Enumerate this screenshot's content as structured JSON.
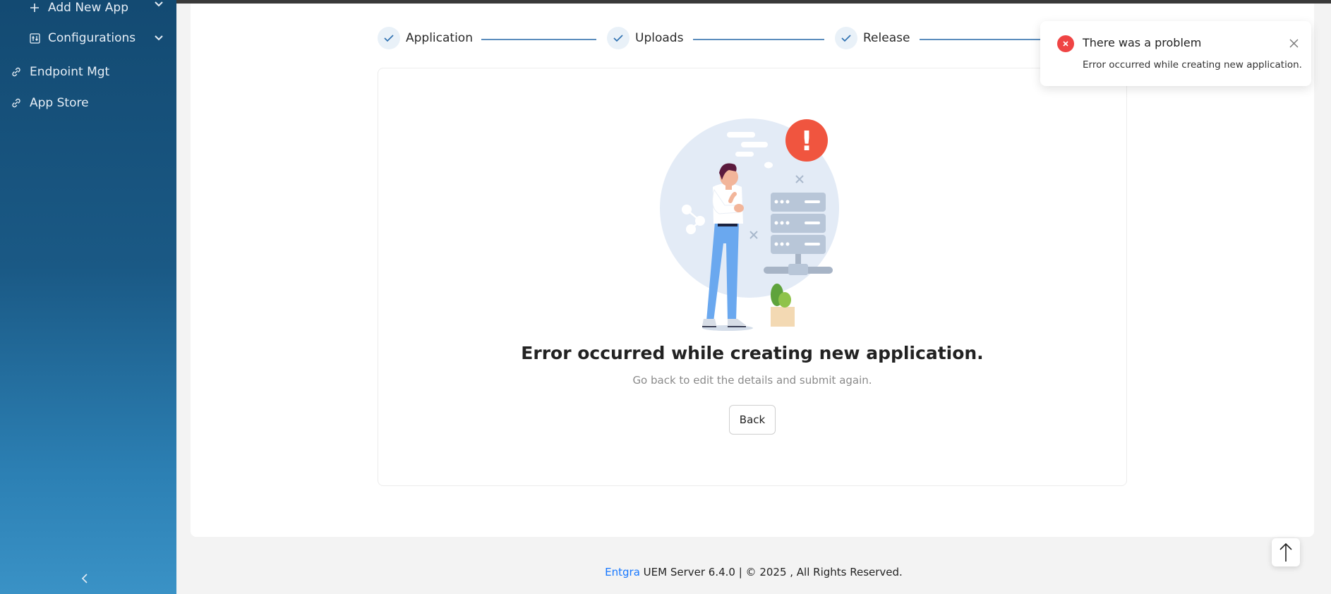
{
  "sidebar": {
    "items": [
      {
        "label": "Add New App",
        "icon": "plus-icon",
        "has_chevron": true
      },
      {
        "label": "Configurations",
        "icon": "sliders-icon",
        "has_chevron": true
      },
      {
        "label": "Endpoint Mgt",
        "icon": "link-icon"
      },
      {
        "label": "App Store",
        "icon": "link-icon"
      }
    ],
    "collapse_icon": "chevron-left-icon"
  },
  "steps": [
    {
      "label": "Application",
      "status": "done"
    },
    {
      "label": "Uploads",
      "status": "done"
    },
    {
      "label": "Release",
      "status": "done"
    }
  ],
  "result": {
    "title": "Error occurred while creating new application.",
    "subtitle": "Go back to edit the details and submit again.",
    "back_label": "Back",
    "illustration_mark": "!"
  },
  "toast": {
    "title": "There was a problem",
    "message": "Error occurred while creating new application.",
    "type": "error"
  },
  "footer": {
    "brand": "Entgra",
    "text": " UEM Server 6.4.0 | © 2025 , All Rights Reserved."
  },
  "colors": {
    "sidebar_top": "#134a72",
    "sidebar_bottom": "#3a92c6",
    "accent": "#1677ff",
    "error": "#ef4444",
    "step_line": "#5b8dbd"
  }
}
